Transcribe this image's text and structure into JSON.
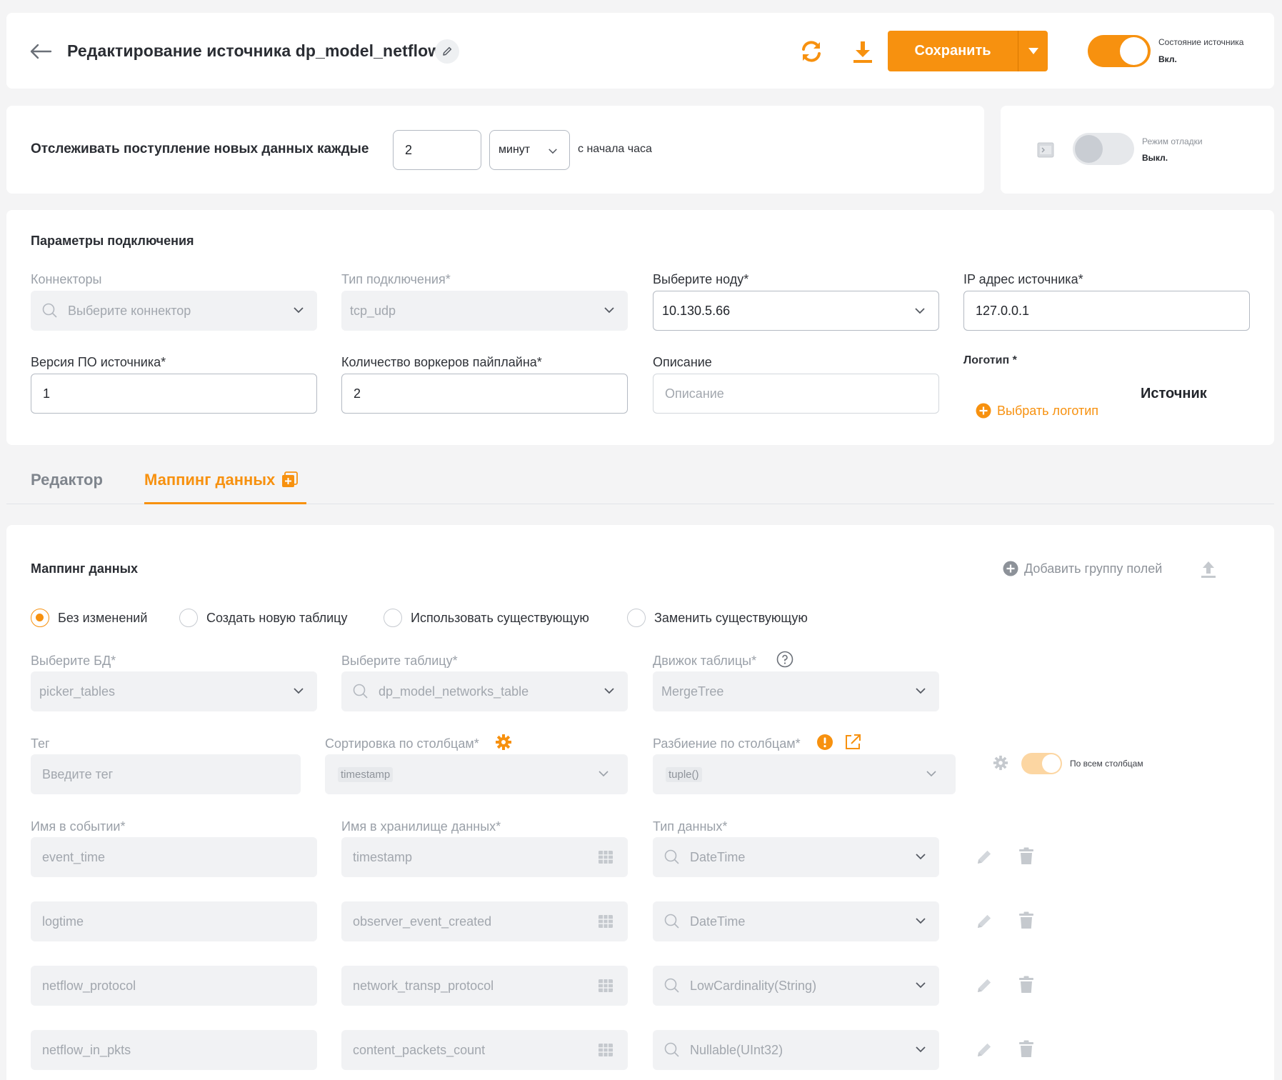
{
  "header": {
    "title": "Редактирование источника dp_model_netflow",
    "save_label": "Сохранить",
    "source_state_label": "Состояние источника",
    "source_state_value": "Вкл."
  },
  "schedule": {
    "label": "Отслеживать поступление новых данных каждые",
    "interval_value": "2",
    "unit_value": "минут",
    "suffix": "с начала часа"
  },
  "debug": {
    "label": "Режим отладки",
    "value": "Выкл."
  },
  "connection": {
    "title": "Параметры подключения",
    "connectors_label": "Коннекторы",
    "connectors_placeholder": "Выберите коннектор",
    "conn_type_label": "Тип подключения*",
    "conn_type_value": "tcp_udp",
    "node_label": "Выберите ноду*",
    "node_value": "10.130.5.66",
    "ip_label": "IP адрес источника*",
    "ip_value": "127.0.0.1",
    "version_label": "Версия ПО источника*",
    "version_value": "1",
    "workers_label": "Количество воркеров пайплайна*",
    "workers_value": "2",
    "description_label": "Описание",
    "description_placeholder": "Описание",
    "logo_label": "Логотип *",
    "logo_button": "Выбрать логотип",
    "logo_text": "Источник"
  },
  "tabs": {
    "editor": "Редактор",
    "mapping": "Маппинг данных"
  },
  "mapping": {
    "title": "Маппинг данных",
    "add_group": "Добавить группу полей",
    "radios": [
      "Без изменений",
      "Создать новую таблицу",
      "Использовать существующую",
      "Заменить существующую"
    ],
    "db_label": "Выберите БД*",
    "db_value": "picker_tables",
    "table_label": "Выберите таблицу*",
    "table_value": "dp_model_networks_table",
    "engine_label": "Движок таблицы*",
    "engine_value": "MergeTree",
    "tag_label": "Тег",
    "tag_placeholder": "Введите тег",
    "sort_label": "Сортировка по столбцам*",
    "sort_value": "timestamp",
    "partition_label": "Разбиение по столбцам*",
    "partition_value": "tuple()",
    "all_columns_label": "По всем столбцам",
    "event_name_label": "Имя в событии*",
    "storage_name_label": "Имя в хранилище данных*",
    "data_type_label": "Тип данных*",
    "rows": [
      {
        "event": "event_time",
        "storage": "timestamp",
        "type": "DateTime"
      },
      {
        "event": "logtime",
        "storage": "observer_event_created",
        "type": "DateTime"
      },
      {
        "event": "netflow_protocol",
        "storage": "network_transp_protocol",
        "type": "LowCardinality(String)"
      },
      {
        "event": "netflow_in_pkts",
        "storage": "content_packets_count",
        "type": "Nullable(UInt32)"
      }
    ]
  },
  "colors": {
    "accent": "#f7910f",
    "background": "#f4f4f5",
    "card": "#ffffff"
  }
}
